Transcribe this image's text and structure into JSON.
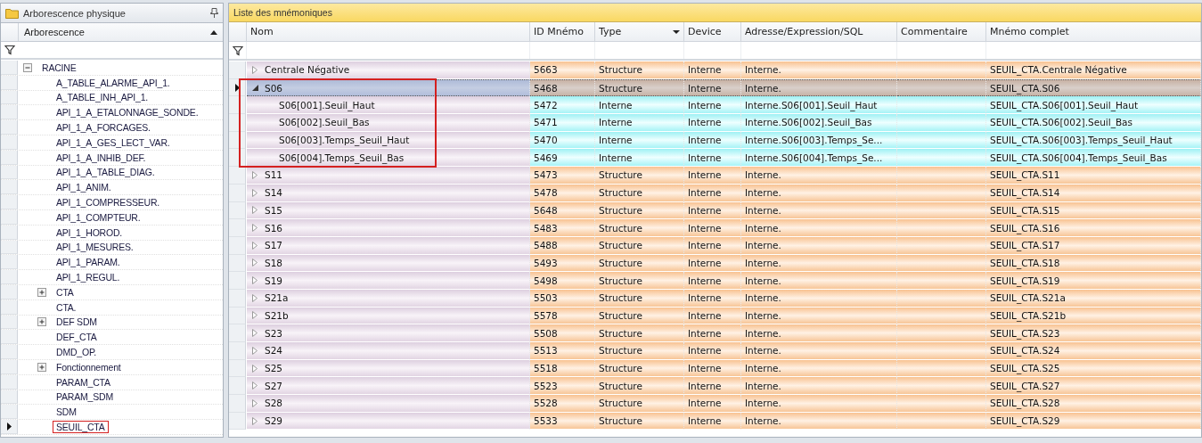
{
  "left_panel": {
    "title": "Arborescence physique",
    "column": "Arborescence",
    "sorted_ascending": true,
    "tree": [
      {
        "label": "RACINE",
        "expanded": true,
        "selected": false,
        "annotated": false,
        "children": [
          {
            "label": "A_TABLE_ALARME_API_1.",
            "selected": false,
            "annotated": false
          },
          {
            "label": "A_TABLE_INH_API_1.",
            "selected": false,
            "annotated": false
          },
          {
            "label": "API_1_A_ETALONNAGE_SONDE.",
            "selected": false,
            "annotated": false
          },
          {
            "label": "API_1_A_FORCAGES.",
            "selected": false,
            "annotated": false
          },
          {
            "label": "API_1_A_GES_LECT_VAR.",
            "selected": false,
            "annotated": false
          },
          {
            "label": "API_1_A_INHIB_DEF.",
            "selected": false,
            "annotated": false
          },
          {
            "label": "API_1_A_TABLE_DIAG.",
            "selected": false,
            "annotated": false
          },
          {
            "label": "API_1_ANIM.",
            "selected": false,
            "annotated": false
          },
          {
            "label": "API_1_COMPRESSEUR.",
            "selected": false,
            "annotated": false
          },
          {
            "label": "API_1_COMPTEUR.",
            "selected": false,
            "annotated": false
          },
          {
            "label": "API_1_HOROD.",
            "selected": false,
            "annotated": false
          },
          {
            "label": "API_1_MESURES.",
            "selected": false,
            "annotated": false
          },
          {
            "label": "API_1_PARAM.",
            "selected": false,
            "annotated": false
          },
          {
            "label": "API_1_REGUL.",
            "selected": false,
            "annotated": false
          },
          {
            "label": "CTA",
            "expanded": false,
            "selected": false,
            "annotated": false
          },
          {
            "label": "CTA.",
            "selected": false,
            "annotated": false
          },
          {
            "label": "DEF SDM",
            "expanded": false,
            "selected": false,
            "annotated": false
          },
          {
            "label": "DEF_CTA",
            "selected": false,
            "annotated": false
          },
          {
            "label": "DMD_OP.",
            "selected": false,
            "annotated": false
          },
          {
            "label": "Fonctionnement",
            "expanded": false,
            "selected": false,
            "annotated": false
          },
          {
            "label": "PARAM_CTA",
            "selected": false,
            "annotated": false
          },
          {
            "label": "PARAM_SDM",
            "selected": false,
            "annotated": false
          },
          {
            "label": "SDM",
            "selected": false,
            "annotated": false
          },
          {
            "label": "SEUIL_CTA",
            "selected": true,
            "annotated": true
          }
        ]
      }
    ]
  },
  "main_panel": {
    "title": "Liste des mnémoniques",
    "columns": [
      {
        "label": "Nom"
      },
      {
        "label": "ID Mnémo"
      },
      {
        "label": "Type",
        "dropdown": true
      },
      {
        "label": "Device"
      },
      {
        "label": "Adresse/Expression/SQL"
      },
      {
        "label": "Commentaire"
      },
      {
        "label": "Mnémo complet"
      }
    ],
    "rows": [
      {
        "name": "Centrale Négative",
        "kind": "structure",
        "expanded": false,
        "selected": false,
        "annotated": false,
        "id": "5663",
        "type": "Structure",
        "device": "Interne",
        "address": "Interne.",
        "full_name": "SEUIL_CTA.Centrale Négative"
      },
      {
        "name": "S06",
        "kind": "structure",
        "expanded": true,
        "selected": true,
        "annotated": true,
        "id": "5468",
        "type": "Structure",
        "device": "Interne",
        "address": "Interne.",
        "full_name": "SEUIL_CTA.S06",
        "children": [
          {
            "name": "S06[001].Seuil_Haut",
            "kind": "variable",
            "selected": false,
            "annotated": true,
            "id": "5472",
            "type": "Interne",
            "device": "Interne",
            "address": "Interne.S06[001].Seuil_Haut",
            "full_name": "SEUIL_CTA.S06[001].Seuil_Haut"
          },
          {
            "name": "S06[002].Seuil_Bas",
            "kind": "variable",
            "selected": false,
            "annotated": true,
            "id": "5471",
            "type": "Interne",
            "device": "Interne",
            "address": "Interne.S06[002].Seuil_Bas",
            "full_name": "SEUIL_CTA.S06[002].Seuil_Bas"
          },
          {
            "name": "S06[003].Temps_Seuil_Haut",
            "kind": "variable",
            "selected": false,
            "annotated": true,
            "id": "5470",
            "type": "Interne",
            "device": "Interne",
            "address": "Interne.S06[003].Temps_Se...",
            "full_name": "SEUIL_CTA.S06[003].Temps_Seuil_Haut"
          },
          {
            "name": "S06[004].Temps_Seuil_Bas",
            "kind": "variable",
            "selected": false,
            "annotated": true,
            "id": "5469",
            "type": "Interne",
            "device": "Interne",
            "address": "Interne.S06[004].Temps_Se...",
            "full_name": "SEUIL_CTA.S06[004].Temps_Seuil_Bas"
          }
        ]
      },
      {
        "name": "S11",
        "kind": "structure",
        "expanded": false,
        "selected": false,
        "annotated": false,
        "id": "5473",
        "type": "Structure",
        "device": "Interne",
        "address": "Interne.",
        "full_name": "SEUIL_CTA.S11"
      },
      {
        "name": "S14",
        "kind": "structure",
        "expanded": false,
        "selected": false,
        "annotated": false,
        "id": "5478",
        "type": "Structure",
        "device": "Interne",
        "address": "Interne.",
        "full_name": "SEUIL_CTA.S14"
      },
      {
        "name": "S15",
        "kind": "structure",
        "expanded": false,
        "selected": false,
        "annotated": false,
        "id": "5648",
        "type": "Structure",
        "device": "Interne",
        "address": "Interne.",
        "full_name": "SEUIL_CTA.S15"
      },
      {
        "name": "S16",
        "kind": "structure",
        "expanded": false,
        "selected": false,
        "annotated": false,
        "id": "5483",
        "type": "Structure",
        "device": "Interne",
        "address": "Interne.",
        "full_name": "SEUIL_CTA.S16"
      },
      {
        "name": "S17",
        "kind": "structure",
        "expanded": false,
        "selected": false,
        "annotated": false,
        "id": "5488",
        "type": "Structure",
        "device": "Interne",
        "address": "Interne.",
        "full_name": "SEUIL_CTA.S17"
      },
      {
        "name": "S18",
        "kind": "structure",
        "expanded": false,
        "selected": false,
        "annotated": false,
        "id": "5493",
        "type": "Structure",
        "device": "Interne",
        "address": "Interne.",
        "full_name": "SEUIL_CTA.S18"
      },
      {
        "name": "S19",
        "kind": "structure",
        "expanded": false,
        "selected": false,
        "annotated": false,
        "id": "5498",
        "type": "Structure",
        "device": "Interne",
        "address": "Interne.",
        "full_name": "SEUIL_CTA.S19"
      },
      {
        "name": "S21a",
        "kind": "structure",
        "expanded": false,
        "selected": false,
        "annotated": false,
        "id": "5503",
        "type": "Structure",
        "device": "Interne",
        "address": "Interne.",
        "full_name": "SEUIL_CTA.S21a"
      },
      {
        "name": "S21b",
        "kind": "structure",
        "expanded": false,
        "selected": false,
        "annotated": false,
        "id": "5578",
        "type": "Structure",
        "device": "Interne",
        "address": "Interne.",
        "full_name": "SEUIL_CTA.S21b"
      },
      {
        "name": "S23",
        "kind": "structure",
        "expanded": false,
        "selected": false,
        "annotated": false,
        "id": "5508",
        "type": "Structure",
        "device": "Interne",
        "address": "Interne.",
        "full_name": "SEUIL_CTA.S23"
      },
      {
        "name": "S24",
        "kind": "structure",
        "expanded": false,
        "selected": false,
        "annotated": false,
        "id": "5513",
        "type": "Structure",
        "device": "Interne",
        "address": "Interne.",
        "full_name": "SEUIL_CTA.S24"
      },
      {
        "name": "S25",
        "kind": "structure",
        "expanded": false,
        "selected": false,
        "annotated": false,
        "id": "5518",
        "type": "Structure",
        "device": "Interne",
        "address": "Interne.",
        "full_name": "SEUIL_CTA.S25"
      },
      {
        "name": "S27",
        "kind": "structure",
        "expanded": false,
        "selected": false,
        "annotated": false,
        "id": "5523",
        "type": "Structure",
        "device": "Interne",
        "address": "Interne.",
        "full_name": "SEUIL_CTA.S27"
      },
      {
        "name": "S28",
        "kind": "structure",
        "expanded": false,
        "selected": false,
        "annotated": false,
        "id": "5528",
        "type": "Structure",
        "device": "Interne",
        "address": "Interne.",
        "full_name": "SEUIL_CTA.S28"
      },
      {
        "name": "S29",
        "kind": "structure",
        "expanded": false,
        "selected": false,
        "annotated": false,
        "id": "5533",
        "type": "Structure",
        "device": "Interne",
        "address": "Interne.",
        "full_name": "SEUIL_CTA.S29"
      }
    ]
  }
}
